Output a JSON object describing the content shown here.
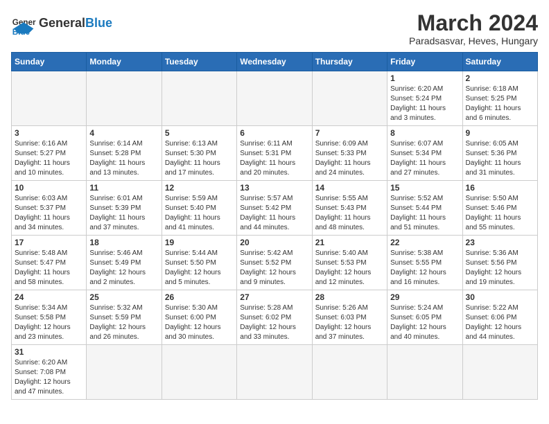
{
  "header": {
    "logo_general": "General",
    "logo_blue": "Blue",
    "title": "March 2024",
    "subtitle": "Paradsasvar, Heves, Hungary"
  },
  "weekdays": [
    "Sunday",
    "Monday",
    "Tuesday",
    "Wednesday",
    "Thursday",
    "Friday",
    "Saturday"
  ],
  "weeks": [
    [
      {
        "day": "",
        "info": ""
      },
      {
        "day": "",
        "info": ""
      },
      {
        "day": "",
        "info": ""
      },
      {
        "day": "",
        "info": ""
      },
      {
        "day": "",
        "info": ""
      },
      {
        "day": "1",
        "info": "Sunrise: 6:20 AM\nSunset: 5:24 PM\nDaylight: 11 hours\nand 3 minutes."
      },
      {
        "day": "2",
        "info": "Sunrise: 6:18 AM\nSunset: 5:25 PM\nDaylight: 11 hours\nand 6 minutes."
      }
    ],
    [
      {
        "day": "3",
        "info": "Sunrise: 6:16 AM\nSunset: 5:27 PM\nDaylight: 11 hours\nand 10 minutes."
      },
      {
        "day": "4",
        "info": "Sunrise: 6:14 AM\nSunset: 5:28 PM\nDaylight: 11 hours\nand 13 minutes."
      },
      {
        "day": "5",
        "info": "Sunrise: 6:13 AM\nSunset: 5:30 PM\nDaylight: 11 hours\nand 17 minutes."
      },
      {
        "day": "6",
        "info": "Sunrise: 6:11 AM\nSunset: 5:31 PM\nDaylight: 11 hours\nand 20 minutes."
      },
      {
        "day": "7",
        "info": "Sunrise: 6:09 AM\nSunset: 5:33 PM\nDaylight: 11 hours\nand 24 minutes."
      },
      {
        "day": "8",
        "info": "Sunrise: 6:07 AM\nSunset: 5:34 PM\nDaylight: 11 hours\nand 27 minutes."
      },
      {
        "day": "9",
        "info": "Sunrise: 6:05 AM\nSunset: 5:36 PM\nDaylight: 11 hours\nand 31 minutes."
      }
    ],
    [
      {
        "day": "10",
        "info": "Sunrise: 6:03 AM\nSunset: 5:37 PM\nDaylight: 11 hours\nand 34 minutes."
      },
      {
        "day": "11",
        "info": "Sunrise: 6:01 AM\nSunset: 5:39 PM\nDaylight: 11 hours\nand 37 minutes."
      },
      {
        "day": "12",
        "info": "Sunrise: 5:59 AM\nSunset: 5:40 PM\nDaylight: 11 hours\nand 41 minutes."
      },
      {
        "day": "13",
        "info": "Sunrise: 5:57 AM\nSunset: 5:42 PM\nDaylight: 11 hours\nand 44 minutes."
      },
      {
        "day": "14",
        "info": "Sunrise: 5:55 AM\nSunset: 5:43 PM\nDaylight: 11 hours\nand 48 minutes."
      },
      {
        "day": "15",
        "info": "Sunrise: 5:52 AM\nSunset: 5:44 PM\nDaylight: 11 hours\nand 51 minutes."
      },
      {
        "day": "16",
        "info": "Sunrise: 5:50 AM\nSunset: 5:46 PM\nDaylight: 11 hours\nand 55 minutes."
      }
    ],
    [
      {
        "day": "17",
        "info": "Sunrise: 5:48 AM\nSunset: 5:47 PM\nDaylight: 11 hours\nand 58 minutes."
      },
      {
        "day": "18",
        "info": "Sunrise: 5:46 AM\nSunset: 5:49 PM\nDaylight: 12 hours\nand 2 minutes."
      },
      {
        "day": "19",
        "info": "Sunrise: 5:44 AM\nSunset: 5:50 PM\nDaylight: 12 hours\nand 5 minutes."
      },
      {
        "day": "20",
        "info": "Sunrise: 5:42 AM\nSunset: 5:52 PM\nDaylight: 12 hours\nand 9 minutes."
      },
      {
        "day": "21",
        "info": "Sunrise: 5:40 AM\nSunset: 5:53 PM\nDaylight: 12 hours\nand 12 minutes."
      },
      {
        "day": "22",
        "info": "Sunrise: 5:38 AM\nSunset: 5:55 PM\nDaylight: 12 hours\nand 16 minutes."
      },
      {
        "day": "23",
        "info": "Sunrise: 5:36 AM\nSunset: 5:56 PM\nDaylight: 12 hours\nand 19 minutes."
      }
    ],
    [
      {
        "day": "24",
        "info": "Sunrise: 5:34 AM\nSunset: 5:58 PM\nDaylight: 12 hours\nand 23 minutes."
      },
      {
        "day": "25",
        "info": "Sunrise: 5:32 AM\nSunset: 5:59 PM\nDaylight: 12 hours\nand 26 minutes."
      },
      {
        "day": "26",
        "info": "Sunrise: 5:30 AM\nSunset: 6:00 PM\nDaylight: 12 hours\nand 30 minutes."
      },
      {
        "day": "27",
        "info": "Sunrise: 5:28 AM\nSunset: 6:02 PM\nDaylight: 12 hours\nand 33 minutes."
      },
      {
        "day": "28",
        "info": "Sunrise: 5:26 AM\nSunset: 6:03 PM\nDaylight: 12 hours\nand 37 minutes."
      },
      {
        "day": "29",
        "info": "Sunrise: 5:24 AM\nSunset: 6:05 PM\nDaylight: 12 hours\nand 40 minutes."
      },
      {
        "day": "30",
        "info": "Sunrise: 5:22 AM\nSunset: 6:06 PM\nDaylight: 12 hours\nand 44 minutes."
      }
    ],
    [
      {
        "day": "31",
        "info": "Sunrise: 6:20 AM\nSunset: 7:08 PM\nDaylight: 12 hours\nand 47 minutes."
      },
      {
        "day": "",
        "info": ""
      },
      {
        "day": "",
        "info": ""
      },
      {
        "day": "",
        "info": ""
      },
      {
        "day": "",
        "info": ""
      },
      {
        "day": "",
        "info": ""
      },
      {
        "day": "",
        "info": ""
      }
    ]
  ]
}
